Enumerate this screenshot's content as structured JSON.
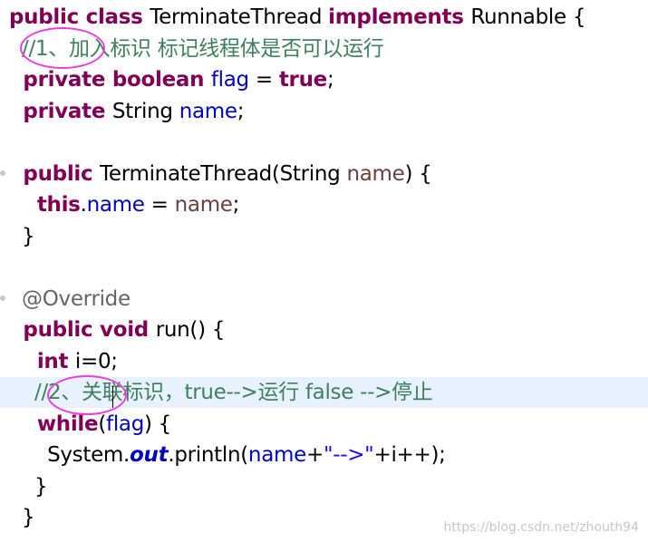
{
  "code": {
    "lines": [
      [
        {
          "text": "public class ",
          "kind": "kw"
        },
        {
          "text": "TerminateThread ",
          "kind": "plain"
        },
        {
          "text": "implements ",
          "kind": "kw"
        },
        {
          "text": "Runnable {",
          "kind": "plain"
        }
      ],
      [
        {
          "text": "  //1、加入标识 标记线程体是否可以运行",
          "kind": "comment"
        }
      ],
      [
        {
          "text": "  private boolean ",
          "kind": "kw"
        },
        {
          "text": "flag",
          "kind": "field"
        },
        {
          "text": " = ",
          "kind": "plain"
        },
        {
          "text": "true",
          "kind": "kw"
        },
        {
          "text": ";",
          "kind": "plain"
        }
      ],
      [
        {
          "text": "  private ",
          "kind": "kw"
        },
        {
          "text": "String ",
          "kind": "plain"
        },
        {
          "text": "name",
          "kind": "field"
        },
        {
          "text": ";",
          "kind": "plain"
        }
      ],
      [
        {
          "text": "",
          "kind": "plain"
        }
      ],
      [
        {
          "text": "  public ",
          "kind": "kw"
        },
        {
          "text": "TerminateThread(String ",
          "kind": "plain"
        },
        {
          "text": "name",
          "kind": "param"
        },
        {
          "text": ") {",
          "kind": "plain"
        }
      ],
      [
        {
          "text": "    this",
          "kind": "kw"
        },
        {
          "text": ".",
          "kind": "plain"
        },
        {
          "text": "name",
          "kind": "field"
        },
        {
          "text": " = ",
          "kind": "plain"
        },
        {
          "text": "name",
          "kind": "param"
        },
        {
          "text": ";",
          "kind": "plain"
        }
      ],
      [
        {
          "text": "  }",
          "kind": "plain"
        }
      ],
      [
        {
          "text": "",
          "kind": "plain"
        }
      ],
      [
        {
          "text": "  @Override",
          "kind": "annotation"
        }
      ],
      [
        {
          "text": "  public void ",
          "kind": "kw"
        },
        {
          "text": "run() {",
          "kind": "plain"
        }
      ],
      [
        {
          "text": "    int ",
          "kind": "kw"
        },
        {
          "text": "i=0;",
          "kind": "plain"
        }
      ],
      [
        {
          "text": "    //2、关联标识，true-->运行 false -->停止",
          "kind": "comment"
        }
      ],
      [
        {
          "text": "    while",
          "kind": "kw"
        },
        {
          "text": "(",
          "kind": "plain"
        },
        {
          "text": "flag",
          "kind": "field"
        },
        {
          "text": ") {",
          "kind": "plain"
        }
      ],
      [
        {
          "text": "      System.",
          "kind": "plain"
        },
        {
          "text": "out",
          "kind": "static-field"
        },
        {
          "text": ".println(",
          "kind": "plain"
        },
        {
          "text": "name",
          "kind": "field"
        },
        {
          "text": "+",
          "kind": "plain"
        },
        {
          "text": "\"-->\"",
          "kind": "string"
        },
        {
          "text": "+i++);",
          "kind": "plain"
        }
      ],
      [
        {
          "text": "    }",
          "kind": "plain"
        }
      ],
      [
        {
          "text": "  }",
          "kind": "plain"
        }
      ]
    ]
  },
  "watermark": "https://blog.csdn.net/zhouth94"
}
